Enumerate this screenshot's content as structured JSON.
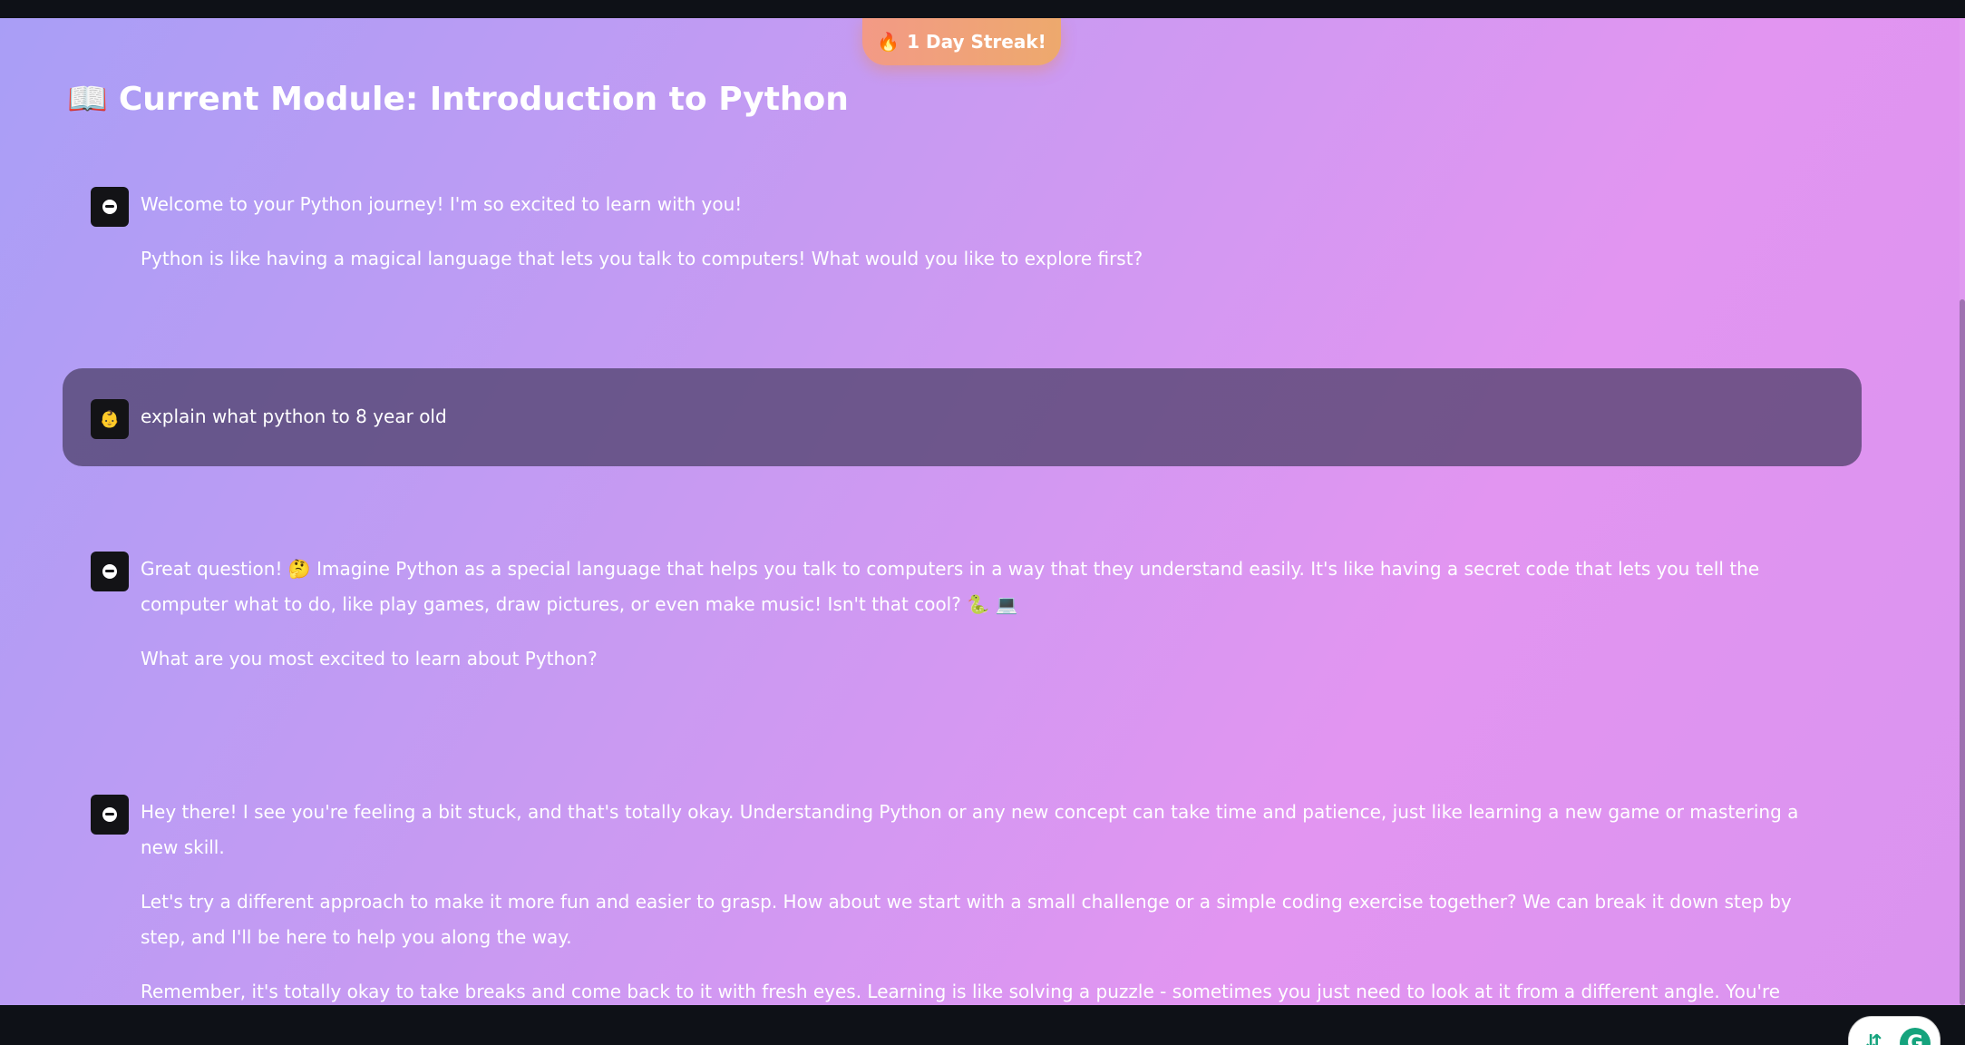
{
  "streak": {
    "icon": "🔥",
    "label": "1 Day Streak!"
  },
  "module": {
    "icon": "📖",
    "title": "Current Module: Introduction to Python"
  },
  "messages": [
    {
      "role": "assistant",
      "avatar": "bot-icon",
      "paragraphs": [
        "Welcome to your Python journey! I'm so excited to learn with you!",
        "Python is like having a magical language that lets you talk to computers! What would you like to explore first?"
      ]
    },
    {
      "role": "user",
      "avatar": "👶",
      "text": "explain what python to 8 year old"
    },
    {
      "role": "assistant",
      "avatar": "bot-icon",
      "paragraphs": [
        "Great question! 🤔 Imagine Python as a special language that helps you talk to computers in a way that they understand easily. It's like having a secret code that lets you tell the computer what to do, like play games, draw pictures, or even make music! Isn't that cool? 🐍 💻",
        "What are you most excited to learn about Python?"
      ]
    },
    {
      "role": "assistant",
      "avatar": "bot-icon",
      "paragraphs": [
        "Hey there! I see you're feeling a bit stuck, and that's totally okay. Understanding Python or any new concept can take time and patience, just like learning a new game or mastering a new skill.",
        "Let's try a different approach to make it more fun and easier to grasp. How about we start with a small challenge or a simple coding exercise together? We can break it down step by step, and I'll be here to help you along the way.",
        "Remember, it's totally okay to take breaks and come back to it with fresh eyes. Learning is like solving a puzzle - sometimes you just need to look at it from a different angle. You're doing great, and I'm here to support you. 🌟"
      ]
    }
  ],
  "grammarly": {
    "letter": "G",
    "icon": "grammarly-icon"
  }
}
